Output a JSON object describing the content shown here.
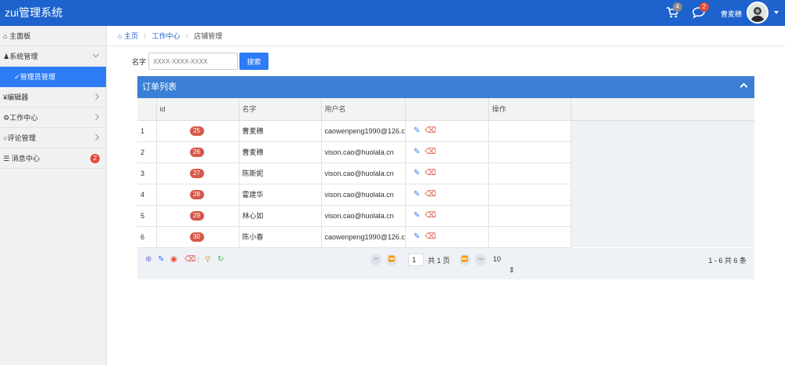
{
  "app": {
    "title": "zui管理系统"
  },
  "topbar": {
    "cart_count": "4",
    "msg_count": "2",
    "user_name": "曹麦穗"
  },
  "sidebar": {
    "items": [
      {
        "label": "主面板",
        "icon": "home-icon"
      },
      {
        "label": "系统管理",
        "icon": "user-icon"
      },
      {
        "label": "管理员管理",
        "icon": "cart-icon"
      },
      {
        "label": "编辑器",
        "icon": "yen-icon"
      },
      {
        "label": "工作中心",
        "icon": "cogs-icon"
      },
      {
        "label": "评论管理",
        "icon": "comments-icon"
      },
      {
        "label": "消息中心",
        "icon": "list-icon",
        "count": "2"
      }
    ]
  },
  "breadcrumb": {
    "home": "主页",
    "work": "工作中心",
    "current": "店铺管理"
  },
  "search": {
    "label": "名字",
    "placeholder": "XXXX-XXXX-XXXX",
    "button": "搜索"
  },
  "panel": {
    "title": "订单列表"
  },
  "table": {
    "headers": [
      "id",
      "名字",
      "用户名",
      "",
      "操作"
    ],
    "rows": [
      {
        "no": "1",
        "id": "25",
        "name": "曹麦穗",
        "user": "caowenpeng1990@126.c"
      },
      {
        "no": "2",
        "id": "26",
        "name": "曹麦穗",
        "user": "vison.cao@huolala.cn"
      },
      {
        "no": "3",
        "id": "27",
        "name": "陈斯妮",
        "user": "vison.cao@huolala.cn"
      },
      {
        "no": "4",
        "id": "28",
        "name": "霍建华",
        "user": "vison.cao@huolala.cn"
      },
      {
        "no": "5",
        "id": "29",
        "name": "林心如",
        "user": "vison.cao@huolala.cn"
      },
      {
        "no": "6",
        "id": "30",
        "name": "陈小春",
        "user": "caowenpeng1990@126.c"
      }
    ]
  },
  "pager": {
    "page": "1",
    "total_pages": "共 1 页",
    "page_size": "10",
    "summary": "1 - 6  共 6 条"
  },
  "colors": {
    "topbar": "#1d62cd",
    "accent": "#2d7bf5",
    "badge": "#d6584a"
  }
}
